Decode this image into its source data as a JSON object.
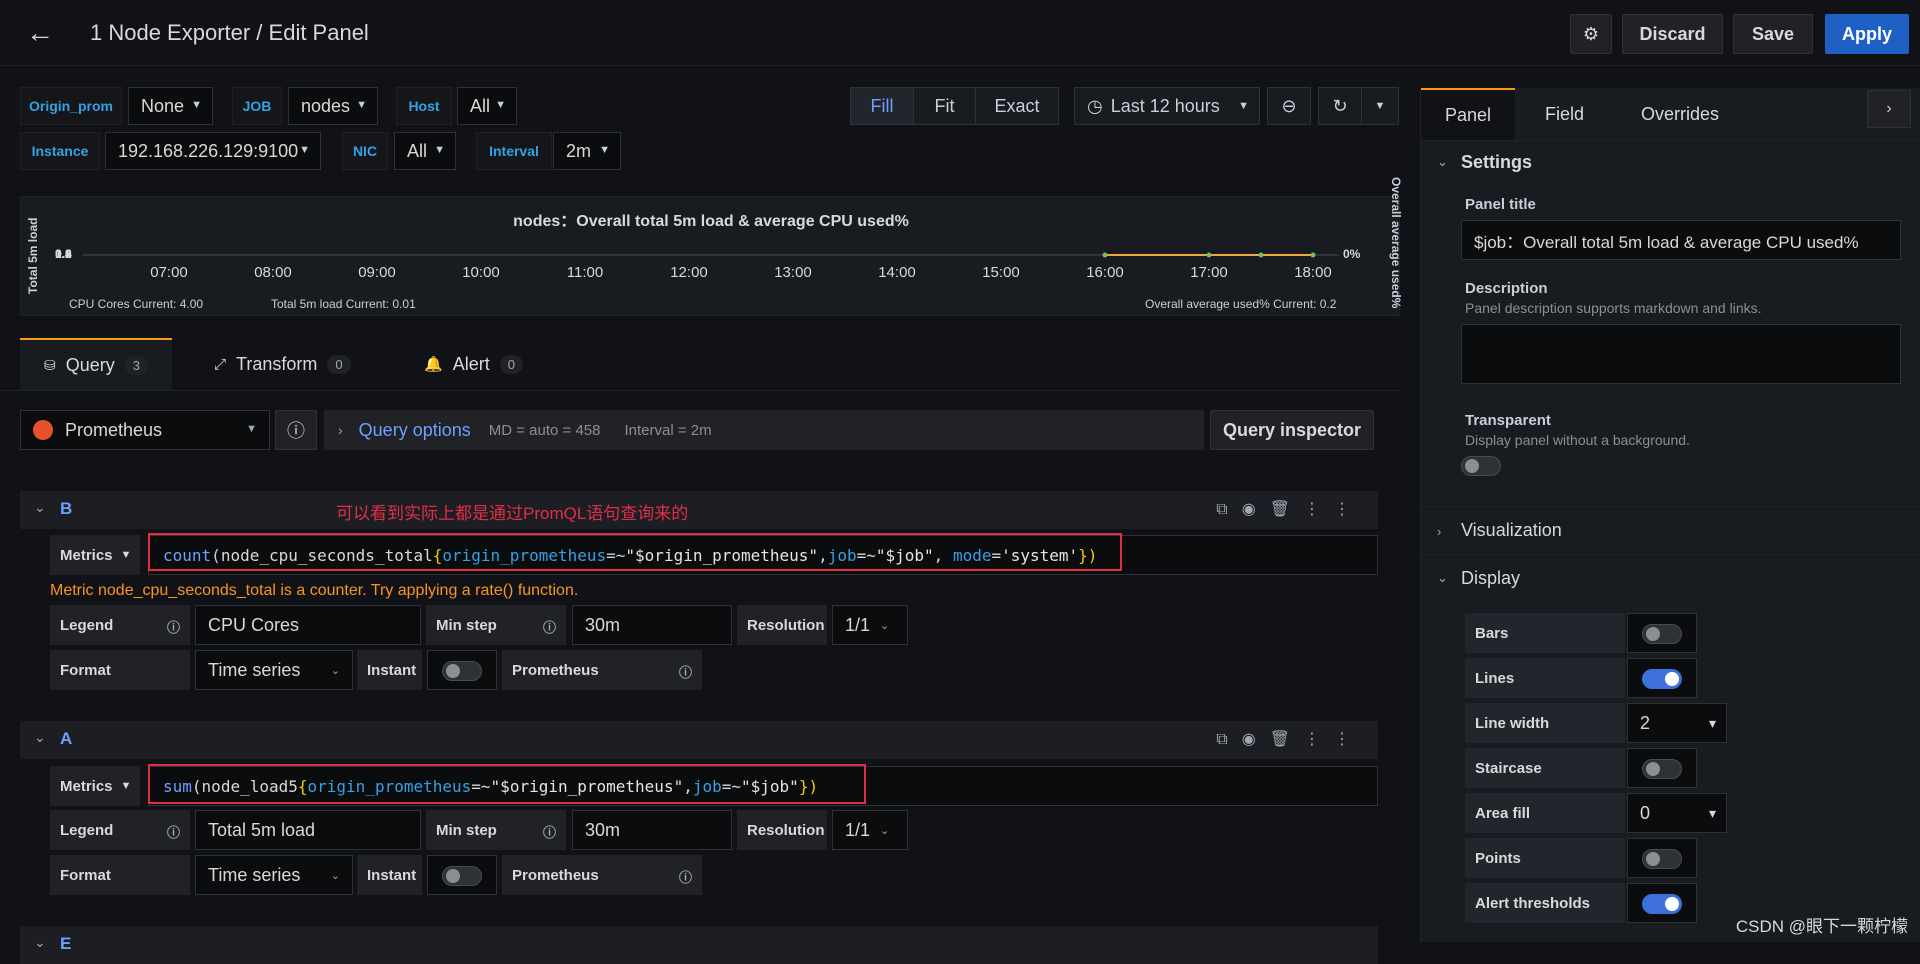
{
  "header": {
    "title": "1 Node Exporter / Edit Panel",
    "discard": "Discard",
    "save": "Save",
    "apply": "Apply"
  },
  "vars": [
    {
      "label": "Origin_prom",
      "value": "None"
    },
    {
      "label": "JOB",
      "value": "nodes"
    },
    {
      "label": "Host",
      "value": "All"
    },
    {
      "label": "Instance",
      "value": "192.168.226.129:9100"
    },
    {
      "label": "NIC",
      "value": "All"
    },
    {
      "label": "Interval",
      "value": "2m"
    }
  ],
  "view": {
    "fill": "Fill",
    "fit": "Fit",
    "exact": "Exact",
    "time_range": "Last 12 hours"
  },
  "panel": {
    "title": "nodes：Overall total 5m load & average CPU used%",
    "ylabel_left": "Total 5m load",
    "ylabel_right": "Overall average used%",
    "y_left_ticks": [
      "1.0",
      "0.8",
      "0.6",
      "0.4",
      "0.2",
      "0"
    ],
    "y_right_tick": "0%",
    "legend_left_1": "CPU Cores  Current: 4.00",
    "legend_left_2": "Total 5m load  Current: 0.01",
    "legend_right": "Overall average used%  Current: 0.2"
  },
  "chart_data": {
    "type": "line",
    "title": "nodes：Overall total 5m load & average CPU used%",
    "x": [
      "07:00",
      "08:00",
      "09:00",
      "10:00",
      "11:00",
      "12:00",
      "13:00",
      "14:00",
      "15:00",
      "16:00",
      "17:00",
      "18:00"
    ],
    "ylabel": "Total 5m load",
    "y2label": "Overall average used%"
  },
  "tabs": {
    "query": "Query",
    "query_count": "3",
    "transform": "Transform",
    "transform_count": "0",
    "alert": "Alert",
    "alert_count": "0"
  },
  "query_bar": {
    "datasource": "Prometheus",
    "options": "Query options",
    "md": "MD = auto = 458",
    "interval": "Interval = 2m",
    "inspector": "Query inspector"
  },
  "annotation": "可以看到实际上都是通过PromQL语句查询来的",
  "queries": [
    {
      "ref": "B",
      "metrics_label": "Metrics",
      "expr": {
        "fn": "count",
        "open": "(",
        "metric": "node_cpu_seconds_total",
        "brace": "{",
        "k1": "origin_prometheus",
        "op1": "=~",
        "v1": "\"$origin_prometheus\"",
        "comma1": ",",
        "k2": "job",
        "op2": "=~",
        "v2": "\"$job\"",
        "comma2": ", ",
        "k3": "mode",
        "op3": "=",
        "v3": "'system'",
        "close": "})"
      },
      "warning": "Metric node_cpu_seconds_total is a counter. Try applying a rate() function.",
      "legend_label": "Legend",
      "legend": "CPU Cores",
      "minstep_label": "Min step",
      "minstep": "30m",
      "res_label": "Resolution",
      "res": "1/1",
      "format_label": "Format",
      "format": "Time series",
      "instant_label": "Instant",
      "prom_label": "Prometheus"
    },
    {
      "ref": "A",
      "metrics_label": "Metrics",
      "expr": {
        "fn": "sum",
        "open": "(",
        "metric": "node_load5",
        "brace": "{",
        "k1": "origin_prometheus",
        "op1": "=~",
        "v1": "\"$origin_prometheus\"",
        "comma1": ",",
        "k2": "job",
        "op2": "=~",
        "v2": "\"$job\"",
        "close": "})"
      },
      "legend_label": "Legend",
      "legend": "Total 5m load",
      "minstep_label": "Min step",
      "minstep": "30m",
      "res_label": "Resolution",
      "res": "1/1",
      "format_label": "Format",
      "format": "Time series",
      "instant_label": "Instant",
      "prom_label": "Prometheus"
    },
    {
      "ref": "E"
    }
  ],
  "side": {
    "tabs": [
      "Panel",
      "Field",
      "Overrides"
    ],
    "settings": "Settings",
    "panel_title_label": "Panel title",
    "panel_title_value": "$job：Overall total 5m load & average CPU used%",
    "desc_label": "Description",
    "desc_hint": "Panel description supports markdown and links.",
    "transparent_label": "Transparent",
    "transparent_hint": "Display panel without a background.",
    "visualization": "Visualization",
    "display": "Display",
    "rows": [
      {
        "label": "Bars",
        "type": "toggle",
        "on": false
      },
      {
        "label": "Lines",
        "type": "toggle",
        "on": true
      },
      {
        "label": "Line width",
        "type": "select",
        "value": "2"
      },
      {
        "label": "Staircase",
        "type": "toggle",
        "on": false
      },
      {
        "label": "Area fill",
        "type": "select",
        "value": "0"
      },
      {
        "label": "Points",
        "type": "toggle",
        "on": false
      },
      {
        "label": "Alert thresholds",
        "type": "toggle",
        "on": true
      }
    ]
  },
  "watermark": "CSDN @眼下一颗柠檬"
}
